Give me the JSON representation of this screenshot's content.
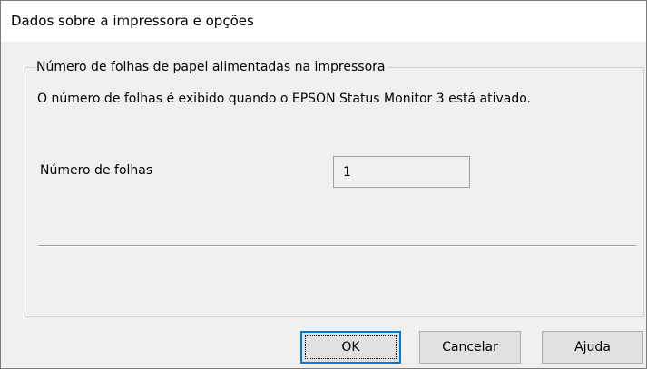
{
  "window": {
    "title": "Dados sobre a impressora e opções"
  },
  "group": {
    "legend": "Número de folhas de papel alimentadas na impressora",
    "info": "O número de folhas é exibido quando o EPSON Status Monitor 3 está ativado.",
    "sheet_count_label": "Número de folhas",
    "sheet_count_value": "1"
  },
  "buttons": {
    "ok": "OK",
    "cancel": "Cancelar",
    "help": "Ajuda"
  },
  "colors": {
    "dialog_background": "#f0f0f0",
    "title_background": "#ffffff",
    "default_button_border": "#0078d7"
  }
}
